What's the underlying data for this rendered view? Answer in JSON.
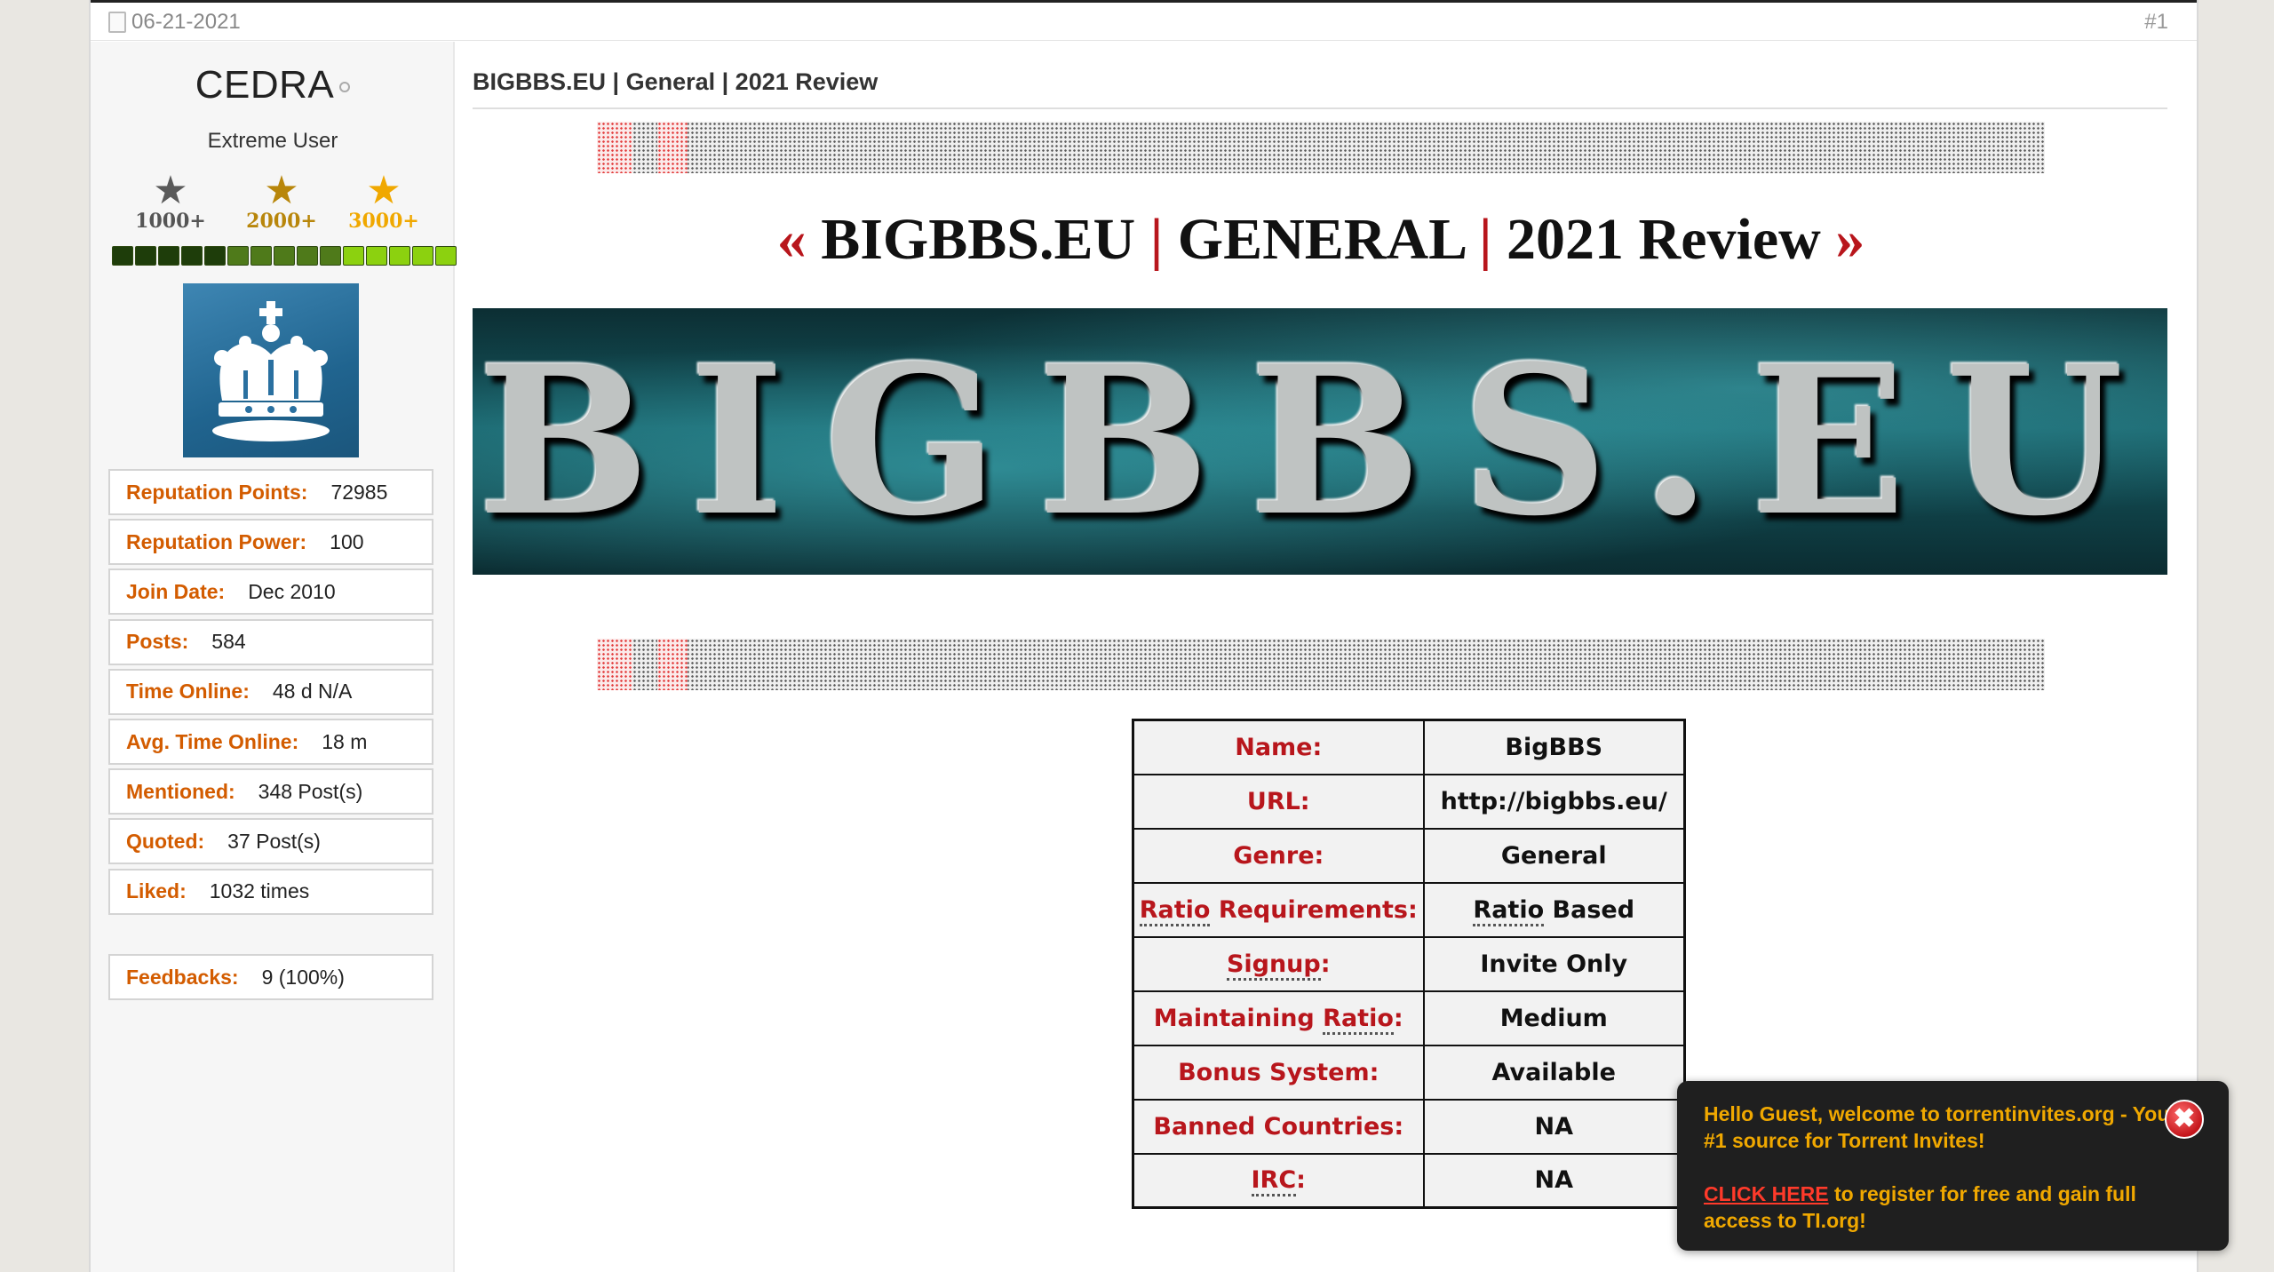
{
  "post": {
    "date": "06-21-2021",
    "number": "#1"
  },
  "user": {
    "name": "CEDRA",
    "title": "Extreme User",
    "stars": [
      {
        "label": "1000+",
        "color": "#5a5a5a"
      },
      {
        "label": "2000+",
        "color": "#b8860b"
      },
      {
        "label": "3000+",
        "color": "#f0a800"
      }
    ],
    "reputation_bar": [
      "#1e3d0a",
      "#1e3d0a",
      "#1e3d0a",
      "#1e3d0a",
      "#1e3d0a",
      "#4f7a1a",
      "#4f7a1a",
      "#4f7a1a",
      "#4f7a1a",
      "#4f7a1a",
      "#8cd10f",
      "#8cd10f",
      "#8cd10f",
      "#8cd10f",
      "#8cd10f"
    ],
    "stats": [
      {
        "key": "Reputation Points:",
        "value": "72985"
      },
      {
        "key": "Reputation Power:",
        "value": "100"
      },
      {
        "key": "Join Date:",
        "value": "Dec 2010"
      },
      {
        "key": "Posts:",
        "value": "584"
      },
      {
        "key": "Time Online:",
        "value": "48 d N/A"
      },
      {
        "key": "Avg. Time Online:",
        "value": "18 m"
      },
      {
        "key": "Mentioned:",
        "value": "348 Post(s)"
      },
      {
        "key": "Quoted:",
        "value": "37 Post(s)"
      },
      {
        "key": "Liked:",
        "value": "1032 times"
      }
    ],
    "feedbacks": {
      "key": "Feedbacks:",
      "value": "9 (100%)"
    }
  },
  "thread": {
    "title": "BIGBBS.EU | General | 2021 Review",
    "heading": {
      "quote_left": "«",
      "part1": "BIGBBS.EU",
      "sep": "|",
      "part2": "GENERAL",
      "part3": "2021 Review",
      "quote_right": "»"
    },
    "banner_text": "BIGBBS.EU"
  },
  "review": {
    "rows": [
      {
        "key": "Name:",
        "value": "BigBBS"
      },
      {
        "key": "URL:",
        "value": "http://bigbbs.eu/"
      },
      {
        "key": "Genre:",
        "value": "General"
      },
      {
        "key": "Ratio Requirements:",
        "value": "Ratio Based"
      },
      {
        "key": "Signup:",
        "value": "Invite Only"
      },
      {
        "key": "Maintaining Ratio:",
        "value": "Medium"
      },
      {
        "key": "Bonus System:",
        "value": "Available"
      },
      {
        "key": "Banned Countries:",
        "value": "NA"
      },
      {
        "key": "IRC:",
        "value": "NA"
      }
    ]
  },
  "popup": {
    "line1": "Hello Guest, welcome to torrentinvites.org - Your #1 source for Torrent Invites!",
    "link": "CLICK HERE",
    "line2": " to register for free and gain full access to TI.org!",
    "close": "✖"
  }
}
